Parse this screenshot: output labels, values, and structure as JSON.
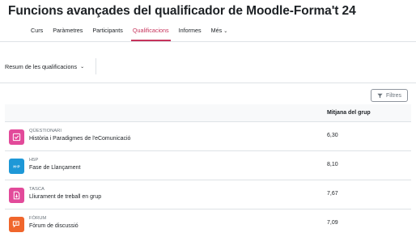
{
  "page": {
    "title": "Funcions avançades del qualificador de Moodle-Forma't 24"
  },
  "tabs": [
    {
      "label": "Curs"
    },
    {
      "label": "Paràmetres"
    },
    {
      "label": "Participants"
    },
    {
      "label": "Qualificacions",
      "active": true
    },
    {
      "label": "Informes"
    },
    {
      "label": "Més"
    }
  ],
  "report_selector": {
    "value": "Resum de les qualificacions"
  },
  "filters": {
    "label": "Filtres"
  },
  "table": {
    "column_header": "Mitjana del grup",
    "rows": [
      {
        "type": "QÜESTIONARI",
        "name": "Història i Paradigmes de l'eComunicació",
        "value": "6,30",
        "icon": "quiz-icon",
        "color": "#e24a9a"
      },
      {
        "type": "H5P",
        "name": "Fase de Llançament",
        "value": "8,10",
        "icon": "h5p-icon",
        "color": "#1e98d7"
      },
      {
        "type": "TASCA",
        "name": "Lliurament de treball en grup",
        "value": "7,67",
        "icon": "assignment-icon",
        "color": "#e24a9a"
      },
      {
        "type": "FÒRUM",
        "name": "Fòrum de discussió",
        "value": "7,09",
        "icon": "forum-icon",
        "color": "#f0662c"
      }
    ]
  }
}
